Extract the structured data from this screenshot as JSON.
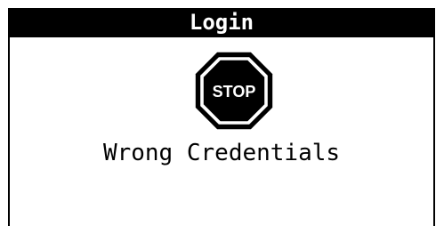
{
  "window": {
    "title": "Login"
  },
  "alert": {
    "icon": "stop-sign-icon",
    "icon_text": "STOP",
    "message": "Wrong Credentials"
  }
}
